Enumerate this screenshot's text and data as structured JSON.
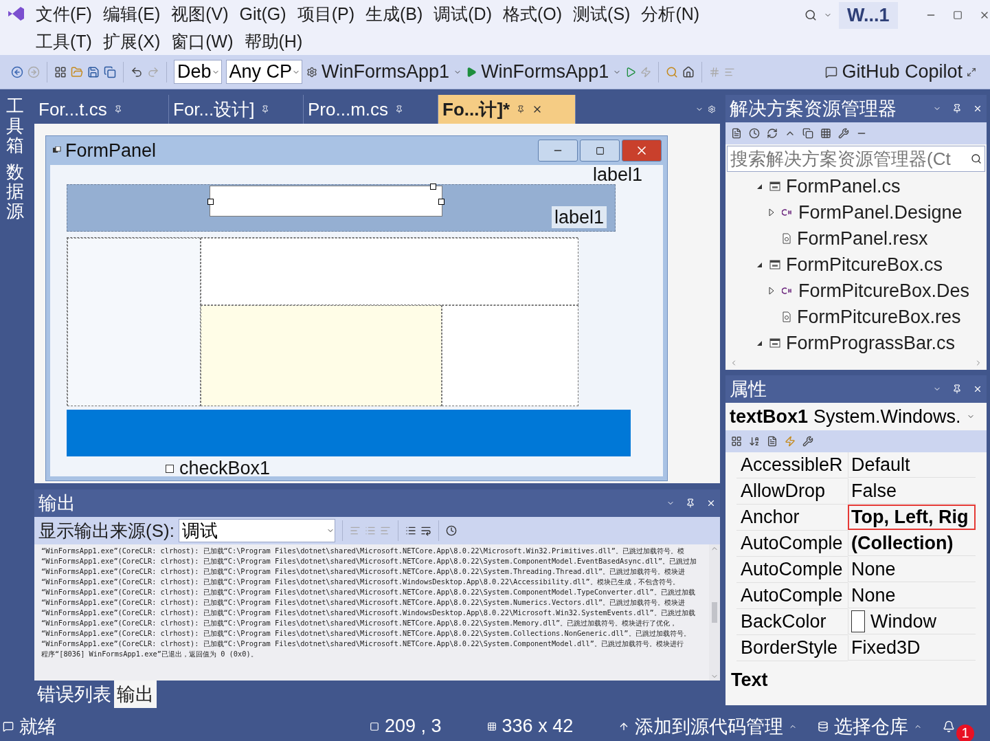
{
  "title_bar": {
    "menu_rows": [
      [
        "文件(F)",
        "编辑(E)",
        "视图(V)",
        "Git(G)",
        "项目(P)",
        "生成(B)",
        "调试(D)",
        "格式(O)",
        "测试(S)",
        "分析(N)"
      ],
      [
        "工具(T)",
        "扩展(X)",
        "窗口(W)",
        "帮助(H)"
      ]
    ],
    "solution_name": "W...1"
  },
  "toolbar": {
    "configuration": "Deb",
    "platform": "Any CP",
    "startup_project": "WinFormsApp1",
    "run_target": "WinFormsApp1",
    "copilot": "GitHub Copilot"
  },
  "side_tabs": [
    "工具箱",
    "数据源"
  ],
  "doc_tabs": [
    {
      "label": "For...t.cs",
      "selected": false
    },
    {
      "label": "For...设计]",
      "selected": false
    },
    {
      "label": "Pro...m.cs",
      "selected": false
    },
    {
      "label": "Fo...计]*",
      "selected": true
    }
  ],
  "designer": {
    "form_title": "FormPanel",
    "labels": [
      "label1",
      "label1"
    ],
    "checkbox": {
      "label": "checkBox1",
      "checked": false
    }
  },
  "output": {
    "title": "输出",
    "source_label": "显示输出来源(S):",
    "source_value": "调试",
    "lines": [
      "“WinFormsApp1.exe”(CoreCLR: clrhost): 已加载“C:\\Program Files\\dotnet\\shared\\Microsoft.NETCore.App\\8.0.22\\Microsoft.Win32.Primitives.dll”。已跳过加载符号。模",
      "“WinFormsApp1.exe”(CoreCLR: clrhost): 已加载“C:\\Program Files\\dotnet\\shared\\Microsoft.NETCore.App\\8.0.22\\System.ComponentModel.EventBasedAsync.dll”。已跳过加",
      "“WinFormsApp1.exe”(CoreCLR: clrhost): 已加载“C:\\Program Files\\dotnet\\shared\\Microsoft.NETCore.App\\8.0.22\\System.Threading.Thread.dll”。已跳过加载符号。模块进",
      "“WinFormsApp1.exe”(CoreCLR: clrhost): 已加载“C:\\Program Files\\dotnet\\shared\\Microsoft.WindowsDesktop.App\\8.0.22\\Accessibility.dll”。模块已生成，不包含符号。",
      "“WinFormsApp1.exe”(CoreCLR: clrhost): 已加载“C:\\Program Files\\dotnet\\shared\\Microsoft.NETCore.App\\8.0.22\\System.ComponentModel.TypeConverter.dll”。已跳过加载",
      "“WinFormsApp1.exe”(CoreCLR: clrhost): 已加载“C:\\Program Files\\dotnet\\shared\\Microsoft.NETCore.App\\8.0.22\\System.Numerics.Vectors.dll”。已跳过加载符号。模块进",
      "“WinFormsApp1.exe”(CoreCLR: clrhost): 已加载“C:\\Program Files\\dotnet\\shared\\Microsoft.WindowsDesktop.App\\8.0.22\\Microsoft.Win32.SystemEvents.dll”。已跳过加载",
      "“WinFormsApp1.exe”(CoreCLR: clrhost): 已加载“C:\\Program Files\\dotnet\\shared\\Microsoft.NETCore.App\\8.0.22\\System.Memory.dll”。已跳过加载符号。模块进行了优化，",
      "“WinFormsApp1.exe”(CoreCLR: clrhost): 已加载“C:\\Program Files\\dotnet\\shared\\Microsoft.NETCore.App\\8.0.22\\System.Collections.NonGeneric.dll”。已跳过加载符号。",
      "“WinFormsApp1.exe”(CoreCLR: clrhost): 已加载“C:\\Program Files\\dotnet\\shared\\Microsoft.NETCore.App\\8.0.22\\System.ComponentModel.dll”。已跳过加载符号。模块进行",
      "程序“[8036] WinFormsApp1.exe”已退出，返回值为 0 (0x0)。"
    ]
  },
  "bottom_tabs": [
    {
      "label": "错误列表",
      "selected": false
    },
    {
      "label": "输出",
      "selected": true
    }
  ],
  "solution_explorer": {
    "title": "解决方案资源管理器",
    "search_placeholder": "搜索解决方案资源管理器(Ct",
    "tree": [
      {
        "label": "FormPanel.cs",
        "kind": "form",
        "expanded": true,
        "children": [
          {
            "label": "FormPanel.Designe",
            "kind": "cs",
            "expanded": false
          },
          {
            "label": "FormPanel.resx",
            "kind": "resx"
          }
        ]
      },
      {
        "label": "FormPitcureBox.cs",
        "kind": "form",
        "expanded": true,
        "children": [
          {
            "label": "FormPitcureBox.Des",
            "kind": "cs",
            "expanded": false
          },
          {
            "label": "FormPitcureBox.res",
            "kind": "resx"
          }
        ]
      },
      {
        "label": "FormPrograssBar.cs",
        "kind": "form",
        "expanded": true
      }
    ]
  },
  "properties": {
    "title": "属性",
    "object": "textBox1",
    "type": "System.Windows.",
    "rows": [
      {
        "name": "AccessibleR",
        "value": "Default",
        "bold": false,
        "kind": "text"
      },
      {
        "name": "AllowDrop",
        "value": "False",
        "bold": false,
        "kind": "text"
      },
      {
        "name": "Anchor",
        "value": "Top, Left, Rig",
        "bold": true,
        "highlighted": true,
        "kind": "text"
      },
      {
        "name": "AutoComple",
        "value": "(Collection)",
        "bold": true,
        "kind": "text"
      },
      {
        "name": "AutoComple",
        "value": "None",
        "bold": false,
        "kind": "text"
      },
      {
        "name": "AutoComple",
        "value": "None",
        "bold": false,
        "kind": "text"
      },
      {
        "name": "BackColor",
        "value": "Window",
        "bold": false,
        "kind": "color"
      },
      {
        "name": "BorderStyle",
        "value": "Fixed3D",
        "bold": false,
        "kind": "text"
      }
    ],
    "description_title": "Text"
  },
  "status_bar": {
    "status": "就绪",
    "position": "209 , 3",
    "size": "336 x 42",
    "source_control": "添加到源代码管理",
    "repo": "选择仓库",
    "notifications": "1"
  }
}
